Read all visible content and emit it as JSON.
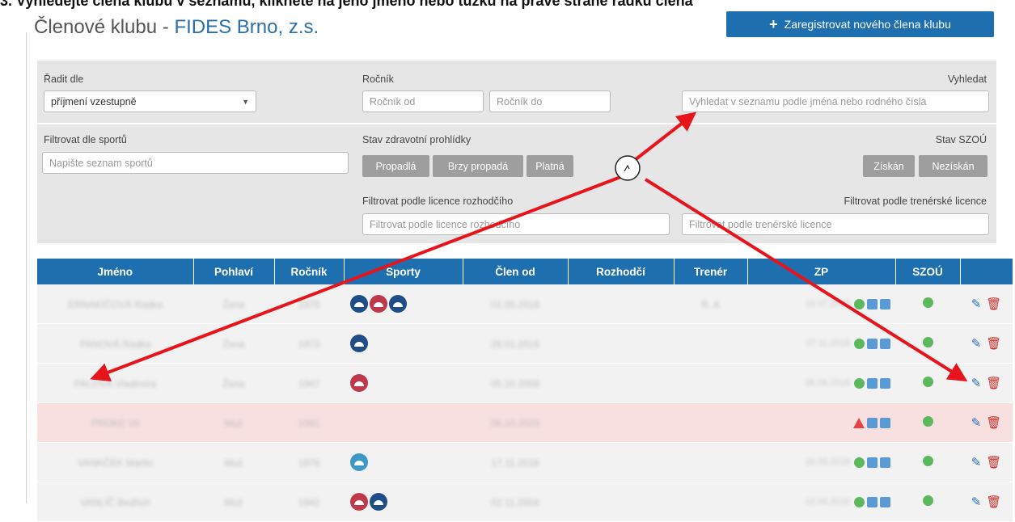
{
  "caption": "3. Vyhledejte člena klubu v seznamu, klikněte na jeho jméno nebo tužku na pravé straně řádku člena",
  "header": {
    "title_prefix": "Členové klubu - ",
    "club_name": "FIDES Brno, z.s.",
    "register_label": "Zaregistrovat nového člena klubu"
  },
  "filters": {
    "sort_label": "Řadit dle",
    "sort_value": "příjmení vzestupně",
    "year_label": "Ročník",
    "year_from_placeholder": "Ročník od",
    "year_to_placeholder": "Ročník do",
    "search_label": "Vyhledat",
    "search_placeholder": "Vyhledat v seznamu podle jména nebo rodného čísla",
    "sports_label": "Filtrovat dle sportů",
    "sports_placeholder": "Napište seznam sportů",
    "health_label": "Stav zdravotní prohlídky",
    "health_options": [
      "Propadlá",
      "Brzy propadá",
      "Platná"
    ],
    "szou_label": "Stav SZOÚ",
    "szou_options": [
      "Získán",
      "Nezískán"
    ],
    "referee_label": "Filtrovat podle licence rozhodčího",
    "referee_placeholder": "Filtrovat podle licence rozhodčího",
    "coach_label": "Filtrovat podle trenérské licence",
    "coach_placeholder": "Filtrovat podle trenérské licence"
  },
  "table": {
    "headers": [
      "Jméno",
      "Pohlaví",
      "Ročník",
      "Sporty",
      "Člen od",
      "Rozhodčí",
      "Trenér",
      "ZP",
      "SZOÚ",
      ""
    ],
    "rows": [
      {
        "name": "ERNAKÍČOVÁ Radka",
        "gender": "Žena",
        "year": "1970",
        "sports": [
          "dark",
          "red",
          "dark"
        ],
        "since": "01.05.2016",
        "referee": "",
        "coach": "R. A",
        "zp_date": "16.07.2018",
        "zp_status": "ok",
        "szou": "ok",
        "alert": false
      },
      {
        "name": "PANOVÁ Radka",
        "gender": "Žena",
        "year": "1973",
        "sports": [
          "dark"
        ],
        "since": "28.01.2016",
        "referee": "",
        "coach": "",
        "zp_date": "07.11.2018",
        "zp_status": "ok",
        "szou": "ok",
        "alert": false
      },
      {
        "name": "PALOVÁ Vladimíra",
        "gender": "Žena",
        "year": "1947",
        "sports": [
          "red"
        ],
        "since": "05.10.2008",
        "referee": "",
        "coach": "",
        "zp_date": "06.06.2018",
        "zp_status": "ok",
        "szou": "ok",
        "alert": false
      },
      {
        "name": "PROKE Vit",
        "gender": "Muž",
        "year": "1991",
        "sports": [],
        "since": "06.10.2020",
        "referee": "",
        "coach": "",
        "zp_date": "",
        "zp_status": "warn",
        "szou": "ok",
        "alert": true
      },
      {
        "name": "VANKČEK Martin",
        "gender": "Muž",
        "year": "1976",
        "sports": [
          "light"
        ],
        "since": "17.11.2018",
        "referee": "",
        "coach": "",
        "zp_date": "26.06.2018",
        "zp_status": "ok",
        "szou": "ok",
        "alert": false
      },
      {
        "name": "VANLÍČ Bedřich",
        "gender": "Muž",
        "year": "1942",
        "sports": [
          "red",
          "dark"
        ],
        "since": "02.11.2004",
        "referee": "",
        "coach": "",
        "zp_date": "12.06.2018",
        "zp_status": "ok",
        "szou": "ok",
        "alert": false
      }
    ]
  },
  "icons": {
    "plus": "plus-icon",
    "pencil": "pencil-icon",
    "trash": "trash-icon",
    "sport": "sport-badge-icon"
  },
  "colors": {
    "primary": "#1e6fb0",
    "panel": "#e6e6e6",
    "alert_row": "#f8e0e0",
    "arrow": "#e8141b"
  }
}
